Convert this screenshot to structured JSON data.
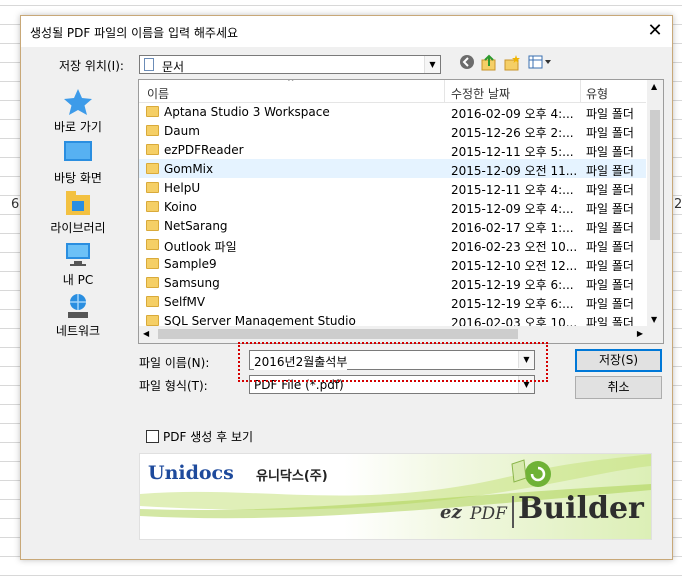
{
  "background": {
    "left_mark": "6",
    "right_mark": "2"
  },
  "dialog": {
    "title": "생성될 PDF 파일의 이름을 입력 해주세요",
    "close_label": "✕"
  },
  "location": {
    "label": "저장 위치(I):",
    "value": "문서"
  },
  "toolbar": {
    "back_icon": "back-arrow-icon",
    "up_icon": "up-folder-icon",
    "new_folder_icon": "new-folder-icon",
    "view_icon": "view-menu-icon"
  },
  "places": [
    {
      "label": "바로 가기",
      "icon": "star-icon"
    },
    {
      "label": "바탕 화면",
      "icon": "desktop-icon"
    },
    {
      "label": "라이브러리",
      "icon": "library-icon"
    },
    {
      "label": "내 PC",
      "icon": "computer-icon"
    },
    {
      "label": "네트워크",
      "icon": "network-icon"
    }
  ],
  "columns": {
    "name": "이름",
    "date": "수정한 날짜",
    "type": "유형"
  },
  "files": [
    {
      "name": "Aptana Studio 3 Workspace",
      "date": "2016-02-09 오후 4:...",
      "type": "파일 폴더"
    },
    {
      "name": "Daum",
      "date": "2015-12-26 오후 2:...",
      "type": "파일 폴더"
    },
    {
      "name": "ezPDFReader",
      "date": "2015-12-11 오후 5:...",
      "type": "파일 폴더"
    },
    {
      "name": "GomMix",
      "date": "2015-12-09 오전 11...",
      "type": "파일 폴더",
      "selected": true
    },
    {
      "name": "HelpU",
      "date": "2015-12-11 오후 4:...",
      "type": "파일 폴더"
    },
    {
      "name": "Koino",
      "date": "2015-12-09 오후 4:...",
      "type": "파일 폴더"
    },
    {
      "name": "NetSarang",
      "date": "2016-02-17 오후 1:...",
      "type": "파일 폴더"
    },
    {
      "name": "Outlook 파일",
      "date": "2016-02-23 오전 10...",
      "type": "파일 폴더"
    },
    {
      "name": "Sample9",
      "date": "2015-12-10 오전 12...",
      "type": "파일 폴더"
    },
    {
      "name": "Samsung",
      "date": "2015-12-19 오후 6:...",
      "type": "파일 폴더"
    },
    {
      "name": "SelfMV",
      "date": "2015-12-19 오후 6:...",
      "type": "파일 폴더"
    },
    {
      "name": "SQL Server Management Studio",
      "date": "2016-02-03 오후 10...",
      "type": "파일 폴더"
    }
  ],
  "filename": {
    "label": "파일 이름(N):",
    "value": "2016년2월출석부"
  },
  "filetype": {
    "label": "파일 형식(T):",
    "value": "PDF File (*.pdf)"
  },
  "buttons": {
    "save": "저장(S)",
    "cancel": "취소"
  },
  "option": {
    "label": "PDF 생성 후 보기",
    "checked": false
  },
  "banner": {
    "logo": "Unidocs",
    "logo_sub": "유니닥스(주)",
    "brand_ez": "ez",
    "brand_pdf": "PDF",
    "brand_builder": "Builder"
  },
  "colors": {
    "highlight": "#d40000",
    "accent": "#0078d7",
    "selected_row": "#e5f3ff",
    "folder": "#f5cf66"
  }
}
